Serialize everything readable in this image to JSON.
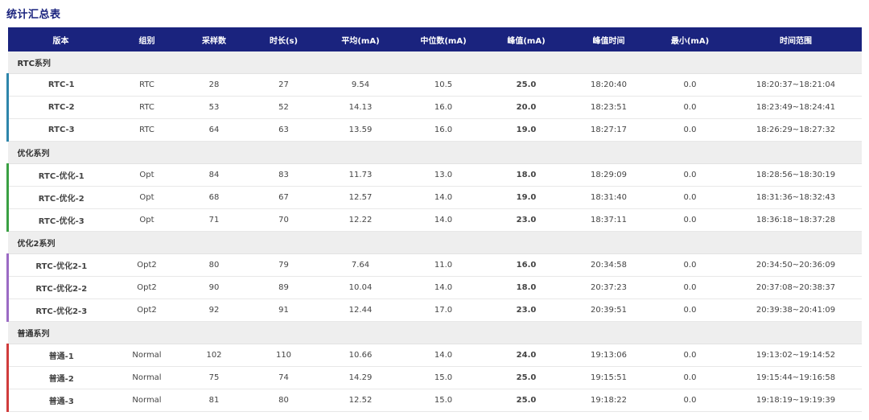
{
  "title": "统计汇总表",
  "headers": [
    "版本",
    "组别",
    "采样数",
    "时长(s)",
    "平均(mA)",
    "中位数(mA)",
    "峰值(mA)",
    "峰值时间",
    "最小(mA)",
    "时间范围"
  ],
  "groups": [
    {
      "name": "RTC系列",
      "color": "#2e86ab",
      "rows": [
        {
          "version": "RTC-1",
          "group": "RTC",
          "samples": "28",
          "duration": "27",
          "avg": "9.54",
          "median": "10.5",
          "peak": "25.0",
          "peak_time": "18:20:40",
          "min": "0.0",
          "range": "18:20:37~18:21:04"
        },
        {
          "version": "RTC-2",
          "group": "RTC",
          "samples": "53",
          "duration": "52",
          "avg": "14.13",
          "median": "16.0",
          "peak": "20.0",
          "peak_time": "18:23:51",
          "min": "0.0",
          "range": "18:23:49~18:24:41"
        },
        {
          "version": "RTC-3",
          "group": "RTC",
          "samples": "64",
          "duration": "63",
          "avg": "13.59",
          "median": "16.0",
          "peak": "19.0",
          "peak_time": "18:27:17",
          "min": "0.0",
          "range": "18:26:29~18:27:32"
        }
      ]
    },
    {
      "name": "优化系列",
      "color": "#3aa043",
      "rows": [
        {
          "version": "RTC-优化-1",
          "group": "Opt",
          "samples": "84",
          "duration": "83",
          "avg": "11.73",
          "median": "13.0",
          "peak": "18.0",
          "peak_time": "18:29:09",
          "min": "0.0",
          "range": "18:28:56~18:30:19"
        },
        {
          "version": "RTC-优化-2",
          "group": "Opt",
          "samples": "68",
          "duration": "67",
          "avg": "12.57",
          "median": "14.0",
          "peak": "19.0",
          "peak_time": "18:31:40",
          "min": "0.0",
          "range": "18:31:36~18:32:43"
        },
        {
          "version": "RTC-优化-3",
          "group": "Opt",
          "samples": "71",
          "duration": "70",
          "avg": "12.22",
          "median": "14.0",
          "peak": "23.0",
          "peak_time": "18:37:11",
          "min": "0.0",
          "range": "18:36:18~18:37:28"
        }
      ]
    },
    {
      "name": "优化2系列",
      "color": "#9b6bc4",
      "rows": [
        {
          "version": "RTC-优化2-1",
          "group": "Opt2",
          "samples": "80",
          "duration": "79",
          "avg": "7.64",
          "median": "11.0",
          "peak": "16.0",
          "peak_time": "20:34:58",
          "min": "0.0",
          "range": "20:34:50~20:36:09"
        },
        {
          "version": "RTC-优化2-2",
          "group": "Opt2",
          "samples": "90",
          "duration": "89",
          "avg": "10.04",
          "median": "14.0",
          "peak": "18.0",
          "peak_time": "20:37:23",
          "min": "0.0",
          "range": "20:37:08~20:38:37"
        },
        {
          "version": "RTC-优化2-3",
          "group": "Opt2",
          "samples": "92",
          "duration": "91",
          "avg": "12.44",
          "median": "17.0",
          "peak": "23.0",
          "peak_time": "20:39:51",
          "min": "0.0",
          "range": "20:39:38~20:41:09"
        }
      ]
    },
    {
      "name": "普通系列",
      "color": "#d03c3c",
      "rows": [
        {
          "version": "普通-1",
          "group": "Normal",
          "samples": "102",
          "duration": "110",
          "avg": "10.66",
          "median": "14.0",
          "peak": "24.0",
          "peak_time": "19:13:06",
          "min": "0.0",
          "range": "19:13:02~19:14:52"
        },
        {
          "version": "普通-2",
          "group": "Normal",
          "samples": "75",
          "duration": "74",
          "avg": "14.29",
          "median": "15.0",
          "peak": "25.0",
          "peak_time": "19:15:51",
          "min": "0.0",
          "range": "19:15:44~19:16:58"
        },
        {
          "version": "普通-3",
          "group": "Normal",
          "samples": "81",
          "duration": "80",
          "avg": "12.52",
          "median": "15.0",
          "peak": "25.0",
          "peak_time": "19:18:22",
          "min": "0.0",
          "range": "19:18:19~19:19:39"
        }
      ]
    }
  ]
}
